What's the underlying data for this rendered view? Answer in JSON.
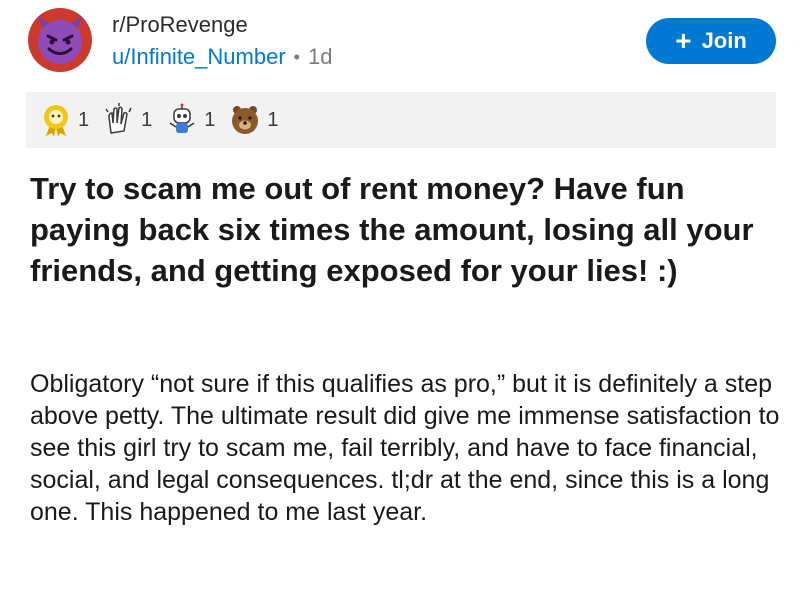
{
  "post": {
    "community": "r/ProRevenge",
    "author": "u/Infinite_Number",
    "separator": "•",
    "age": "1d",
    "join_label": "Join",
    "join_icon": "plus-icon",
    "title": "Try to scam me out of rent money? Have fun paying back six times the amount, losing all your friends, and getting exposed for your lies! :)",
    "body": "Obligatory “not sure if this qualifies as pro,” but it is definitely a step above petty. The ultimate result did give me immense satisfaction to see this girl try to scam me, fail terribly, and have to face financial, social, and legal consequences. tl;dr at the end, since this is a long one. This happened to me last year."
  },
  "avatar": {
    "icon": "devil-smiley-icon",
    "color": "#cc3a2e"
  },
  "accent_color": "#0079d3",
  "awards": [
    {
      "icon": "gold-award-icon",
      "count": "1"
    },
    {
      "icon": "clapping-hands-award-icon",
      "count": "1"
    },
    {
      "icon": "robot-award-icon",
      "count": "1"
    },
    {
      "icon": "bear-award-icon",
      "count": "1"
    }
  ]
}
